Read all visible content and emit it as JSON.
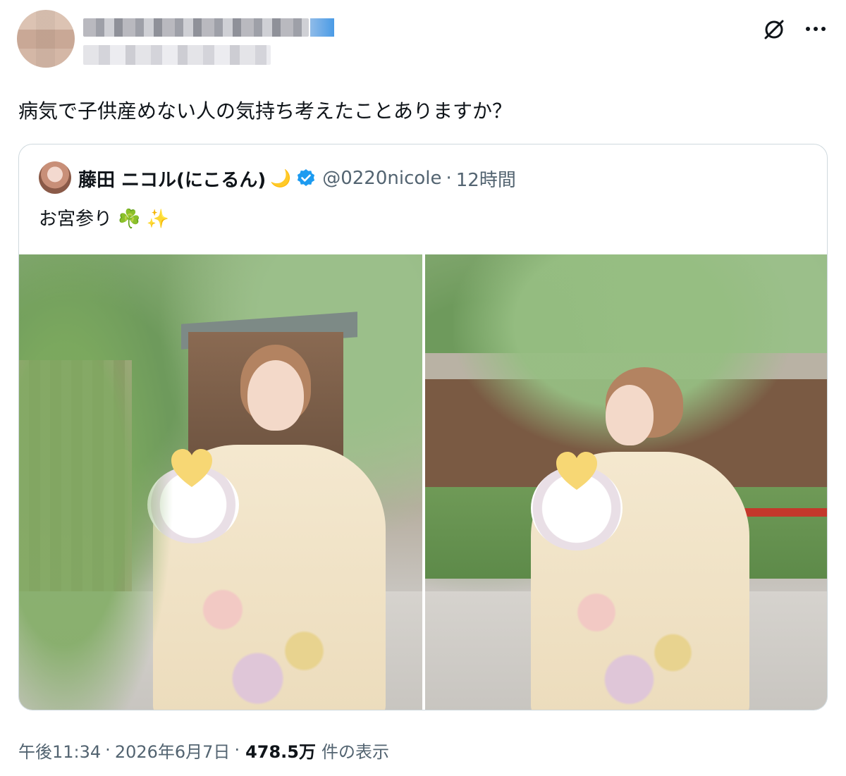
{
  "author": {
    "name": "",
    "handle": ""
  },
  "tweet": {
    "text": "病気で子供産めない人の気持ち考えたことありますか？"
  },
  "quoted_tweet": {
    "name": "藤田 ニコル(にこるん)",
    "name_emoji": "🌙",
    "handle": "@0220nicole",
    "separator": "·",
    "time": "12時間",
    "text": "お宮参り",
    "text_emoji_1": "☘️",
    "text_emoji_2": "✨",
    "verified_color": "#1d9bf0"
  },
  "meta": {
    "time": "午後11:34",
    "sep1": "·",
    "date": "2026年6月7日",
    "sep2": "·",
    "views": "478.5万",
    "views_label": "件の表示"
  },
  "icons": {
    "grok": "grok-icon",
    "more": "more-icon"
  }
}
